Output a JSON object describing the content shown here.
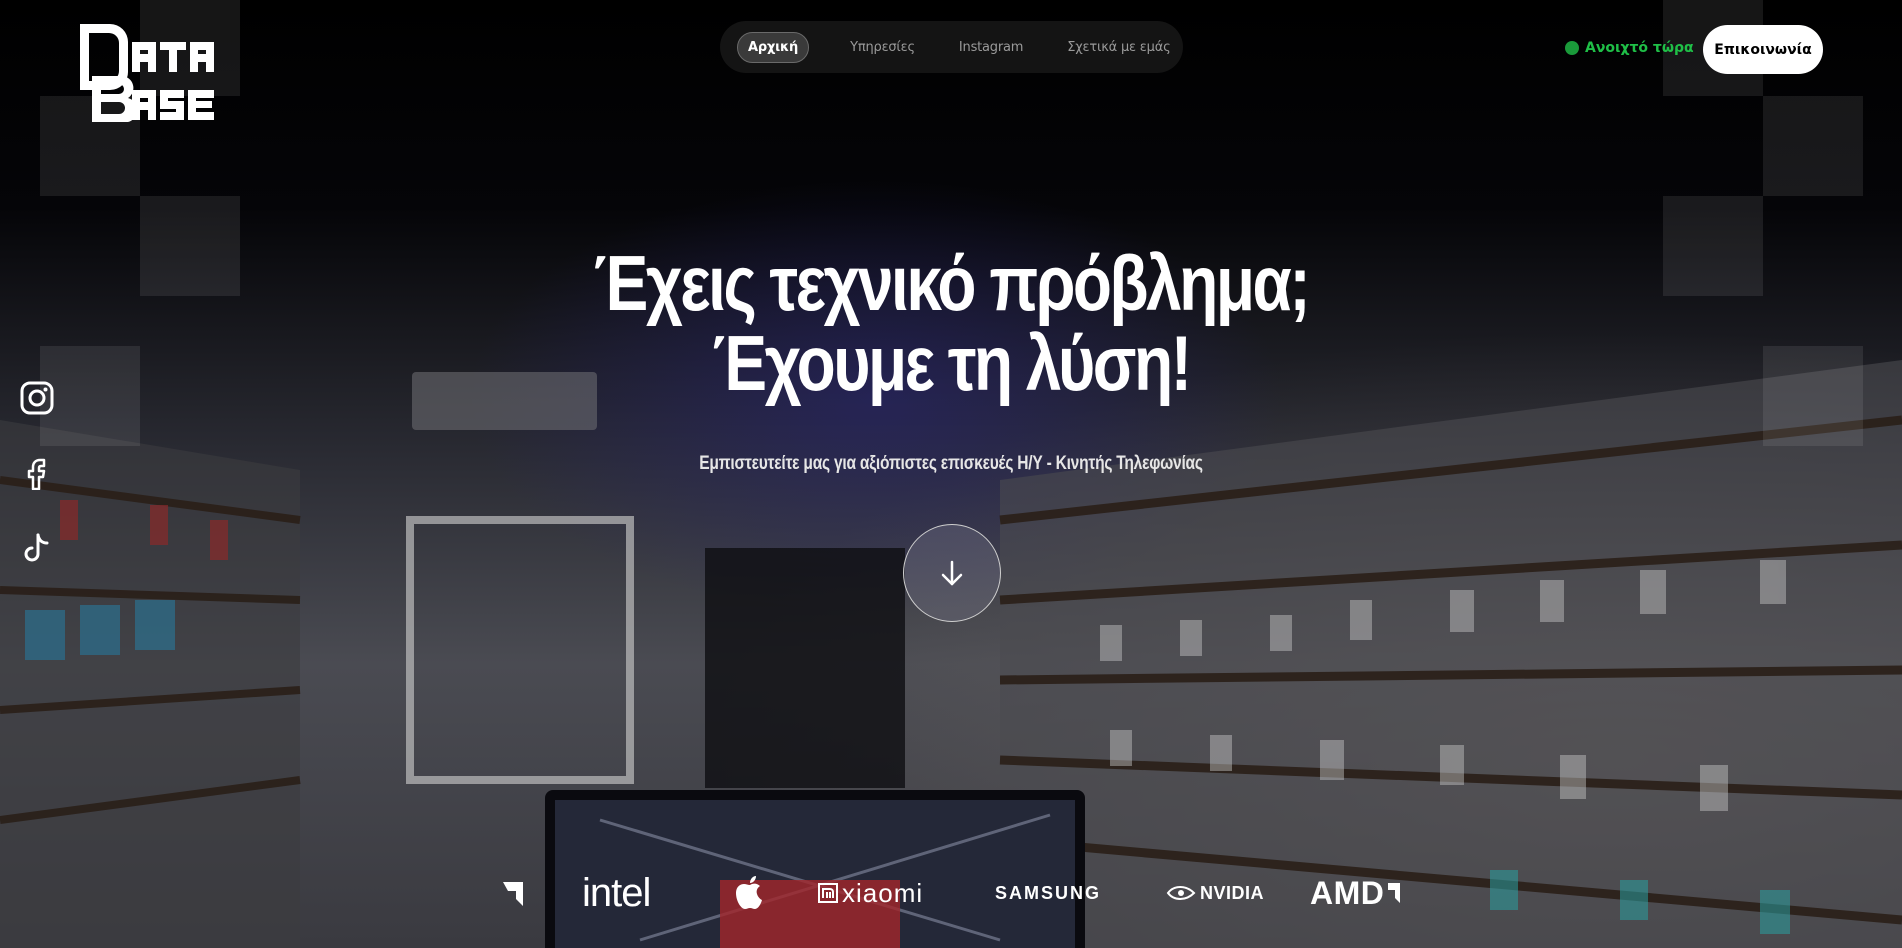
{
  "header": {
    "logo_alt": "DATA BASE",
    "nav": [
      {
        "label": "Αρχική",
        "active": true
      },
      {
        "label": "Υπηρεσίες",
        "active": false
      },
      {
        "label": "Instagram",
        "active": false
      },
      {
        "label": "Σχετικά με εμάς",
        "active": false
      }
    ],
    "status_label": "Ανοιχτό τώρα",
    "status_color": "#1fbf47",
    "contact_label": "Επικοινωνία"
  },
  "socials": [
    {
      "icon": "instagram-icon"
    },
    {
      "icon": "facebook-icon"
    },
    {
      "icon": "tiktok-icon"
    }
  ],
  "hero": {
    "title_line1": "Έχεις τεχνικό πρόβλημα;",
    "title_line2": "Έχουμε τη λύση!",
    "subtitle": "Εμπιστευτείτε μας για αξιόπιστες επισκευές Η/Υ - Κινητής Τηλεφωνίας",
    "scroll_icon": "arrow-down-icon"
  },
  "brands": [
    "intel",
    "xiaomi",
    "SAMSUNG",
    "NVIDIA",
    "AMD"
  ]
}
